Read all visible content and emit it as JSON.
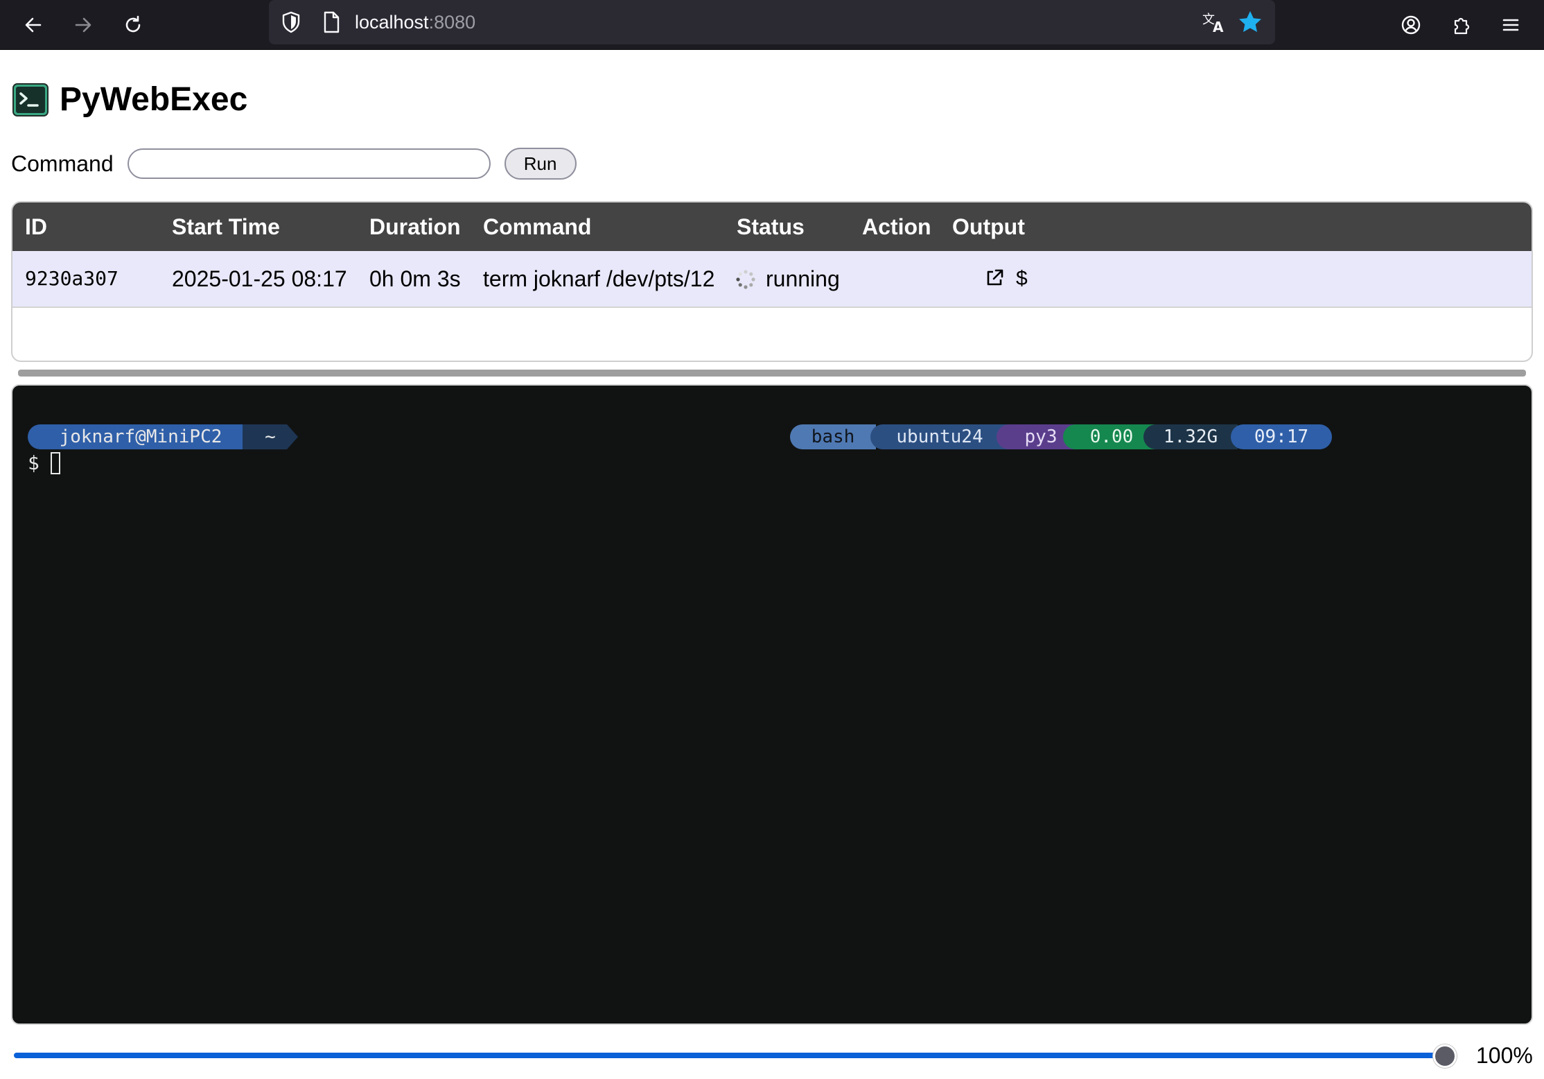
{
  "browser": {
    "url_host": "localhost",
    "url_port": ":8080",
    "accent_star_color": "#1fb0f0"
  },
  "app": {
    "title": "PyWebExec",
    "logo": "terminal-logo-icon"
  },
  "command_form": {
    "label": "Command",
    "input_value": "",
    "run_label": "Run"
  },
  "table": {
    "headers": [
      "ID",
      "Start Time",
      "Duration",
      "Command",
      "Status",
      "Action",
      "Output"
    ],
    "rows": [
      {
        "id": "9230a307",
        "start_time": "2025-01-25 08:17",
        "duration": "0h 0m 3s",
        "command": "term joknarf /dev/pts/12",
        "status": "running",
        "output_link": "$"
      }
    ]
  },
  "terminal": {
    "prompt_user": "joknarf@MiniPC2",
    "prompt_dir": "~",
    "status_segments": {
      "shell": "bash",
      "os": "ubuntu24",
      "python": "py3",
      "load": "0.00",
      "mem": "1.32G",
      "time": "09:17"
    },
    "prompt_symbol": "$",
    "colors": {
      "background": "#111313",
      "user_segment": "#2f5fa8",
      "load_segment": "#15884f",
      "py_segment": "#5a3e8c"
    }
  },
  "zoom": {
    "value_label": "100%",
    "fraction": 1.0
  }
}
